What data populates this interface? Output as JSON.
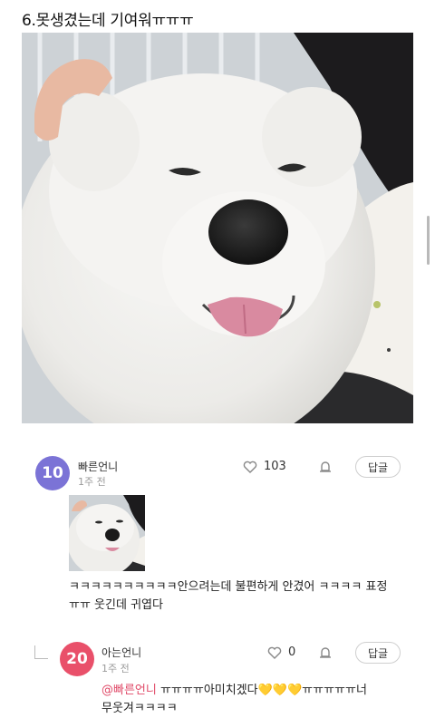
{
  "post": {
    "title": "6.못생겼는데 기여워ㅠㅠㅠ"
  },
  "comments": [
    {
      "avatar_level": "10",
      "avatar_color": "#7b73d6",
      "author": "빠른언니",
      "time": "1주 전",
      "likes": "103",
      "reply_label": "답글",
      "text_line1": "ㅋㅋㅋㅋㅋㅋㅋㅋㅋㅋ안으려는데 불편하게 안겼어 ㅋㅋㅋㅋ 표정",
      "text_line2": "ㅠㅠ 웃긴데 귀엽다"
    },
    {
      "avatar_level": "20",
      "avatar_color": "#e9506a",
      "author": "아는언니",
      "time": "1주 전",
      "likes": "0",
      "reply_label": "답글",
      "mention": "@빠른언니",
      "text_line1_rest": " ㅠㅠㅠㅠ아미치겠다💛💛💛ㅠㅠㅠㅠㅠ너",
      "text_line2": "무웃겨ㅋㅋㅋㅋ"
    }
  ]
}
